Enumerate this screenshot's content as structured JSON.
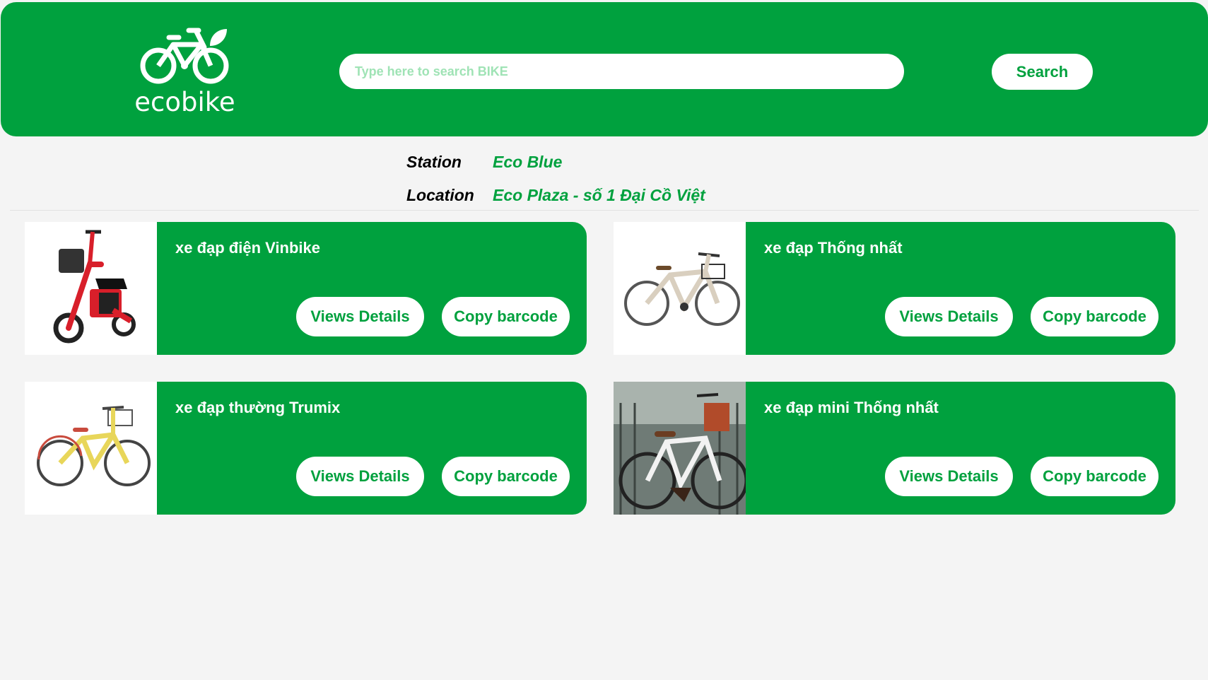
{
  "header": {
    "logo_text": "ecobike",
    "search_placeholder": "Type here to search BIKE",
    "search_value": "",
    "search_button": "Search"
  },
  "station": {
    "station_label": "Station",
    "station_value": "Eco Blue",
    "location_label": "Location",
    "location_value": "Eco Plaza - số 1 Đại Cồ Việt"
  },
  "bikes": [
    {
      "name": "xe đạp điện Vinbike",
      "details_label": "Views Details",
      "copy_label": "Copy barcode",
      "image": "electric-bike-image"
    },
    {
      "name": "xe đạp Thống nhất",
      "details_label": "Views Details",
      "copy_label": "Copy barcode",
      "image": "city-bike-image"
    },
    {
      "name": "xe đạp thường Trumix",
      "details_label": "Views Details",
      "copy_label": "Copy barcode",
      "image": "kids-bike-image"
    },
    {
      "name": "xe đạp mini Thống nhất",
      "details_label": "Views Details",
      "copy_label": "Copy barcode",
      "image": "mini-bike-photo"
    }
  ],
  "colors": {
    "brand_green": "#00a13e",
    "background": "#f4f4f4",
    "placeholder": "#9fe3b5"
  }
}
